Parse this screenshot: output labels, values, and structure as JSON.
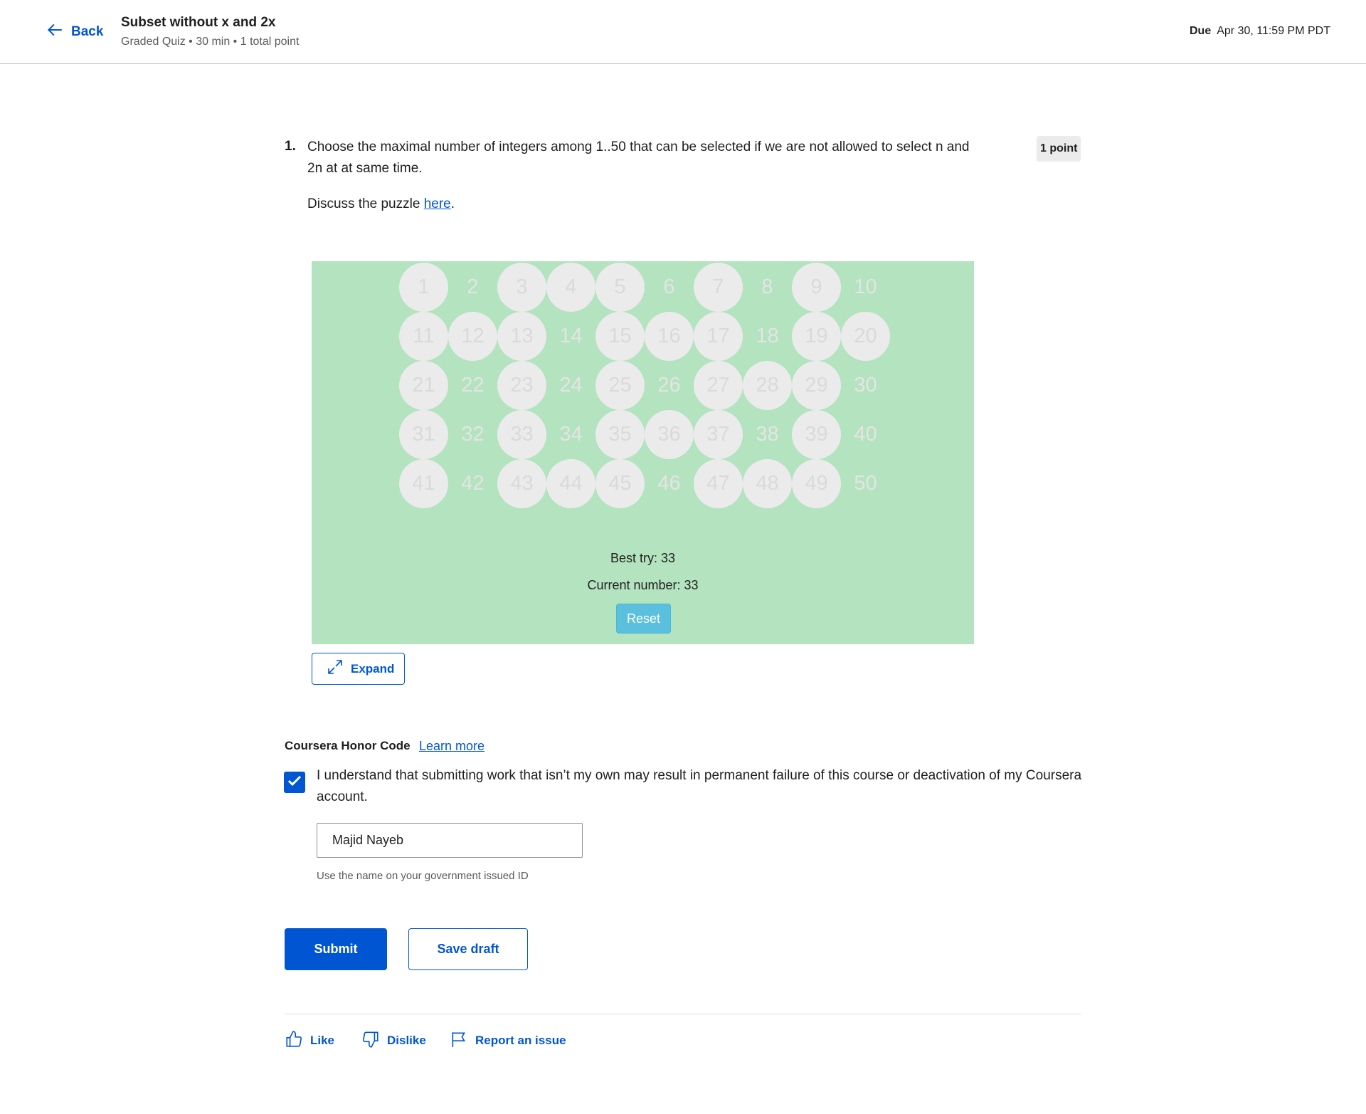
{
  "header": {
    "back_label": "Back",
    "title": "Subset without x and 2x",
    "subtitle": "Graded Quiz • 30 min • 1 total point",
    "due_label": "Due",
    "due_value": "Apr 30, 11:59 PM PDT"
  },
  "question": {
    "number": "1.",
    "text": "Choose the maximal number of integers among 1..50 that can be selected if we are not allowed to select n and 2n at at same time.",
    "points": "1 point",
    "discuss_prefix": "Discuss the puzzle ",
    "discuss_link": "here",
    "discuss_suffix": "."
  },
  "puzzle": {
    "numbers": [
      1,
      2,
      3,
      4,
      5,
      6,
      7,
      8,
      9,
      10,
      11,
      12,
      13,
      14,
      15,
      16,
      17,
      18,
      19,
      20,
      21,
      22,
      23,
      24,
      25,
      26,
      27,
      28,
      29,
      30,
      31,
      32,
      33,
      34,
      35,
      36,
      37,
      38,
      39,
      40,
      41,
      42,
      43,
      44,
      45,
      46,
      47,
      48,
      49,
      50
    ],
    "selected": [
      1,
      3,
      4,
      5,
      7,
      9,
      11,
      12,
      13,
      15,
      16,
      17,
      19,
      20,
      21,
      23,
      25,
      27,
      28,
      29,
      31,
      33,
      35,
      36,
      37,
      39,
      41,
      43,
      44,
      45,
      47,
      48,
      49
    ],
    "best_try": "Best try: 33",
    "current_number": "Current number: 33",
    "reset_label": "Reset",
    "background_color": "#b3e3bf",
    "selected_color": "#ebebeb"
  },
  "expand_label": "Expand",
  "honor": {
    "heading": "Coursera Honor Code",
    "learn_more": "Learn more",
    "checked": true,
    "statement": "I understand that submitting work that isn’t my own may result in permanent failure of this course or deactivation of my Coursera account.",
    "name_value": "Majid Nayeb",
    "hint": "Use the name on your government issued ID"
  },
  "actions": {
    "submit_label": "Submit",
    "save_label": "Save draft"
  },
  "feedback": {
    "like_label": "Like",
    "dislike_label": "Dislike",
    "report_label": "Report an issue"
  },
  "colors": {
    "accent": "#0056d2",
    "reset_button": "#5bc0de"
  }
}
